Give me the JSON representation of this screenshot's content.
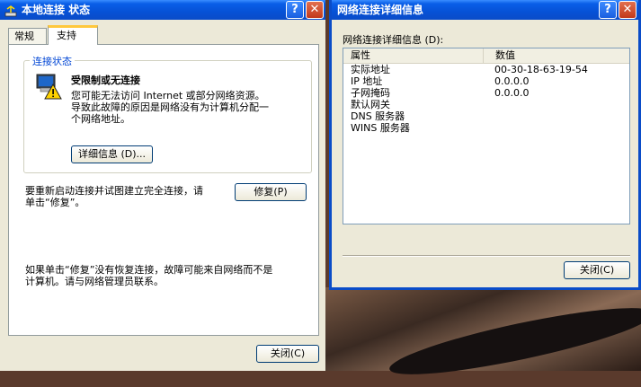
{
  "left_dialog": {
    "title": "本地连接 状态",
    "tabs": [
      "常规",
      "支持"
    ],
    "group_title": "连接状态",
    "status_heading": "受限制或无连接",
    "status_lines": [
      "您可能无法访问 Internet 或部分网络资源。",
      "导致此故障的原因是网络没有为计算机分配一",
      "个网络地址。"
    ],
    "details_button": "详细信息 (D)...",
    "repair_text_lines": [
      "要重新启动连接并试图建立完全连接，请",
      "单击“修复”。"
    ],
    "repair_button": "修复(P)",
    "note_lines": [
      "如果单击“修复”没有恢复连接，故障可能来自网络而不是",
      "计算机。请与网络管理员联系。"
    ],
    "close_button": "关闭(C)"
  },
  "right_dialog": {
    "title": "网络连接详细信息",
    "list_label": "网络连接详细信息 (D):",
    "columns": [
      "属性",
      "数值"
    ],
    "rows": [
      {
        "prop": "实际地址",
        "value": "00-30-18-63-19-54"
      },
      {
        "prop": "IP 地址",
        "value": "0.0.0.0"
      },
      {
        "prop": "子网掩码",
        "value": "0.0.0.0"
      },
      {
        "prop": "默认网关",
        "value": ""
      },
      {
        "prop": "DNS 服务器",
        "value": ""
      },
      {
        "prop": "WINS 服务器",
        "value": ""
      }
    ],
    "close_button": "关闭(C)"
  },
  "title_buttons": {
    "help": "?",
    "close": "✕"
  },
  "colors": {
    "titlebar": "#0a5fe8",
    "dialog_bg": "#ece9d8",
    "group_title": "#0046d5"
  }
}
